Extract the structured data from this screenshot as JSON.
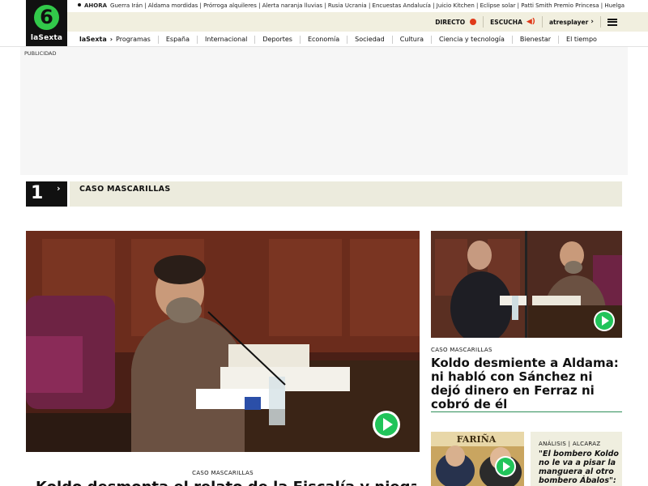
{
  "header": {
    "logo_text": "laSexta",
    "logo_number": "6",
    "ahora_label": "AHORA",
    "ticker": "Guerra Irán | Aldama mordidas | Prórroga alquileres | Alerta naranja lluvias | Rusia Ucrania | Encuestas Andalucía | Juicio Kitchen | Eclipse solar | Patti Smith Premio Princesa | Huelga",
    "directo_label": "DIRECTO",
    "escucha_label": "ESCUCHA",
    "atresplayer_label": "atresplayer"
  },
  "nav": {
    "brand": "laSexta",
    "arrow": "›",
    "items": [
      "Programas",
      "España",
      "Internacional",
      "Deportes",
      "Economía",
      "Sociedad",
      "Cultura",
      "Ciencia y tecnología",
      "Bienestar",
      "El tiempo"
    ]
  },
  "ad": {
    "label": "PUBLICIDAD"
  },
  "section": {
    "number": "1",
    "chevron": "›",
    "title": "CASO MASCARILLAS"
  },
  "main_story": {
    "kicker": "CASO MASCARILLAS",
    "headline": "Koldo desmonta el relato de la Fiscalía y niega el"
  },
  "side_story": {
    "kicker": "CASO MASCARILLAS",
    "headline": "Koldo desmiente a Aldama: ni habló con Sánchez ni dejó dinero en Ferraz ni cobró de él"
  },
  "opinion": {
    "kicker": "ANÁLISIS | ALCARAZ",
    "text": "\"El bombero Koldo no le va a pisar la manguera al otro bombero Ábalos\":",
    "thumb_caption": "FARIÑA"
  },
  "colors": {
    "brand_green": "#32c94a",
    "play_green": "#21c45a",
    "live_red": "#e03a1a",
    "banner_beige": "#ecebdd"
  }
}
